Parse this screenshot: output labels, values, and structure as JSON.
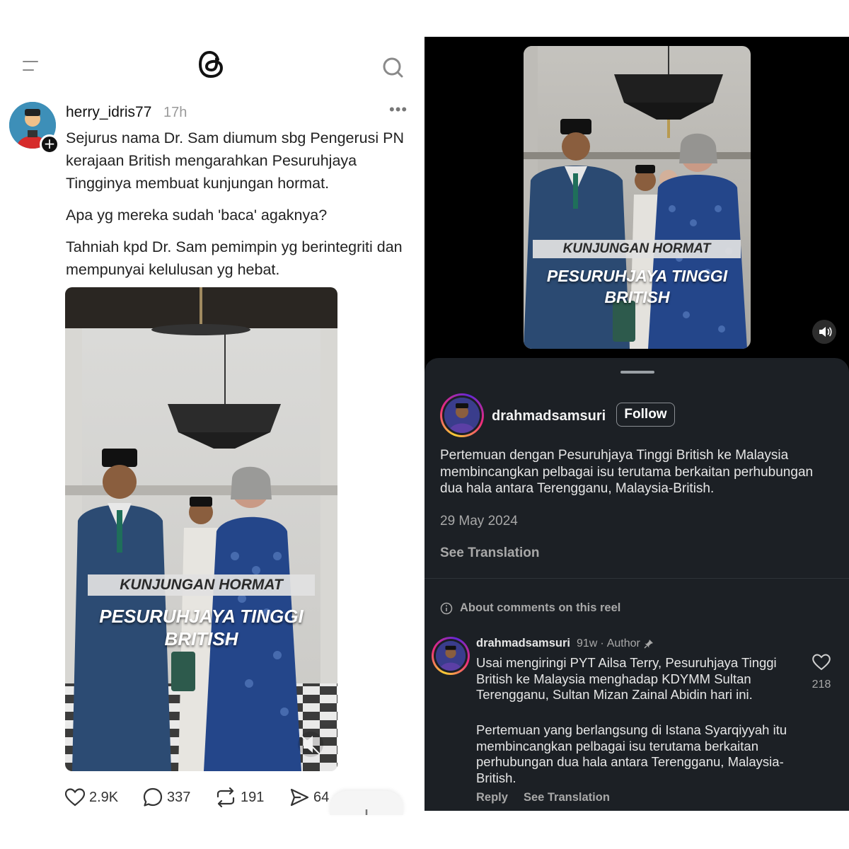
{
  "threads": {
    "author": "herry_idris77",
    "time": "17h",
    "paragraphs": [
      "Sejurus nama Dr. Sam diumum sbg Pengerusi PN kerajaan British mengarahkan Pesuruhjaya Tingginya membuat kunjungan hormat.",
      "Apa yg mereka sudah 'baca' agaknya?",
      "Tahniah kpd Dr. Sam pemimpin yg berintegriti dan mempunyai kelulusan yg hebat."
    ],
    "video_caption_top": "KUNJUNGAN HORMAT",
    "video_caption_line1": "PESURUHJAYA TINGGI",
    "video_caption_line2": "BRITISH",
    "likes": "2.9K",
    "comments": "337",
    "reposts": "191",
    "shares": "64"
  },
  "instagram": {
    "video_caption_top": "KUNJUNGAN HORMAT",
    "video_caption_line1": "PESURUHJAYA TINGGI",
    "video_caption_line2": "BRITISH",
    "author": "drahmadsamsuri",
    "follow_label": "Follow",
    "caption": "Pertemuan dengan Pesuruhjaya Tinggi British ke Malaysia membincangkan pelbagai isu terutama berkaitan perhubungan dua hala antara Terengganu, Malaysia-British.",
    "date": "29 May 2024",
    "see_translation": "See Translation",
    "about_comments": "About comments on this reel",
    "comment": {
      "author": "drahmadsamsuri",
      "age": "91w",
      "separator": "·",
      "role": "Author",
      "p1": "Usai mengiringi PYT Ailsa Terry, Pesuruhjaya Tinggi British ke Malaysia menghadap KDYMM Sultan Terengganu, Sultan Mizan Zainal Abidin hari ini.",
      "p2": "Pertemuan yang berlangsung di Istana Syarqiyyah itu membincangkan pelbagai isu terutama berkaitan perhubungan dua hala antara Terengganu, Malaysia-British.",
      "reply": "Reply",
      "see_translation": "See Translation",
      "likes": "218"
    }
  }
}
